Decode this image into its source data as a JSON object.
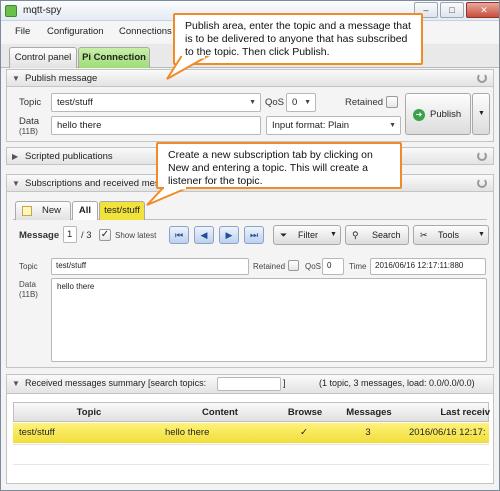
{
  "window": {
    "title": "mqtt-spy",
    "controls": {
      "minimize": "–",
      "maximize": "□",
      "close": "✕"
    }
  },
  "menu": [
    "File",
    "Configuration",
    "Connections"
  ],
  "tabs": [
    {
      "label": "Control panel",
      "active": false
    },
    {
      "label": "Pi Connection",
      "active": true
    }
  ],
  "publish": {
    "section_title": "Publish message",
    "topic_label": "Topic",
    "topic_value": "test/stuff",
    "qos_label": "QoS",
    "qos_value": "0",
    "retained_label": "Retained",
    "publish_button": "Publish",
    "data_label": "Data",
    "data_size": "(11B)",
    "data_value": "hello there",
    "input_format": "Input format: Plain"
  },
  "scripted": {
    "section_title": "Scripted publications"
  },
  "subscriptions": {
    "section_title": "Subscriptions and received mes...",
    "tabs": {
      "new": "New",
      "all": "All",
      "topic": "test/stuff"
    },
    "message_label": "Message",
    "message_index": "1",
    "message_total": "/ 3",
    "show_latest": "Show latest",
    "filter_label": "Filter",
    "search_label": "Search",
    "tools_label": "Tools",
    "detail": {
      "topic_label": "Topic",
      "topic_value": "test/stuff",
      "retained_label": "Retained",
      "qos_label": "QoS",
      "qos_value": "0",
      "time_label": "Time",
      "time_value": "2016/06/16 12:17:11:880",
      "data_label": "Data",
      "data_size": "(11B)",
      "data_value": "hello there"
    }
  },
  "summary": {
    "title": "Received messages summary [search topics:",
    "search_placeholder": "",
    "bracket": "]",
    "stats": "(1 topic, 3 messages, load: 0.0/0.0/0.0)",
    "columns": [
      "Topic",
      "Content",
      "Browse",
      "Messages",
      "Last receiv"
    ],
    "rows": [
      {
        "topic": "test/stuff",
        "content": "hello there",
        "browse": "✓",
        "messages": "3",
        "last": "2016/06/16 12:17:"
      }
    ]
  },
  "callouts": {
    "publish": "Publish area, enter the topic and a message that is to be delivered to anyone that has subscribed to the topic.  Then click Publish.",
    "subscribe": "Create a new subscription tab by clicking on New and entering a topic. This will create a listener for the topic."
  },
  "colors": {
    "accent_green": "#9fdc78",
    "highlight_yellow": "#f7e84a",
    "callout_border": "#f08c28"
  }
}
